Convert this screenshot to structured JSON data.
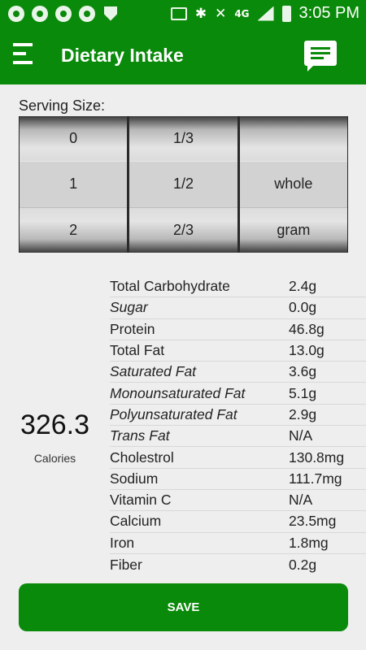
{
  "status_bar": {
    "time": "3:05 PM",
    "network": "4G"
  },
  "app_bar": {
    "title": "Dietary Intake",
    "menu_icon": "hamburger-menu-icon",
    "action_icon": "chat-message-icon"
  },
  "serving": {
    "label": "Serving Size:",
    "columns": [
      [
        "0",
        "1",
        "2"
      ],
      [
        "1/3",
        "1/2",
        "2/3"
      ],
      [
        "",
        "whole",
        "gram"
      ]
    ]
  },
  "calories": {
    "value": "326.3",
    "label": "Calories"
  },
  "nutrients": [
    {
      "name": "Total Carbohydrate",
      "value": "2.4g",
      "italic": false
    },
    {
      "name": "Sugar",
      "value": "0.0g",
      "italic": true
    },
    {
      "name": "Protein",
      "value": "46.8g",
      "italic": false
    },
    {
      "name": "Total Fat",
      "value": "13.0g",
      "italic": false
    },
    {
      "name": "Saturated Fat",
      "value": "3.6g",
      "italic": true
    },
    {
      "name": "Monounsaturated Fat",
      "value": "5.1g",
      "italic": true
    },
    {
      "name": "Polyunsaturated Fat",
      "value": "2.9g",
      "italic": true
    },
    {
      "name": "Trans Fat",
      "value": "N/A",
      "italic": true
    },
    {
      "name": "Cholestrol",
      "value": "130.8mg",
      "italic": false
    },
    {
      "name": "Sodium",
      "value": "111.7mg",
      "italic": false
    },
    {
      "name": "Vitamin C",
      "value": "N/A",
      "italic": false
    },
    {
      "name": "Calcium",
      "value": "23.5mg",
      "italic": false
    },
    {
      "name": "Iron",
      "value": "1.8mg",
      "italic": false
    },
    {
      "name": "Fiber",
      "value": "0.2g",
      "italic": false
    }
  ],
  "save_button": {
    "label": "SAVE"
  },
  "colors": {
    "primary": "#0a8a0a",
    "background": "#eeeeee"
  }
}
